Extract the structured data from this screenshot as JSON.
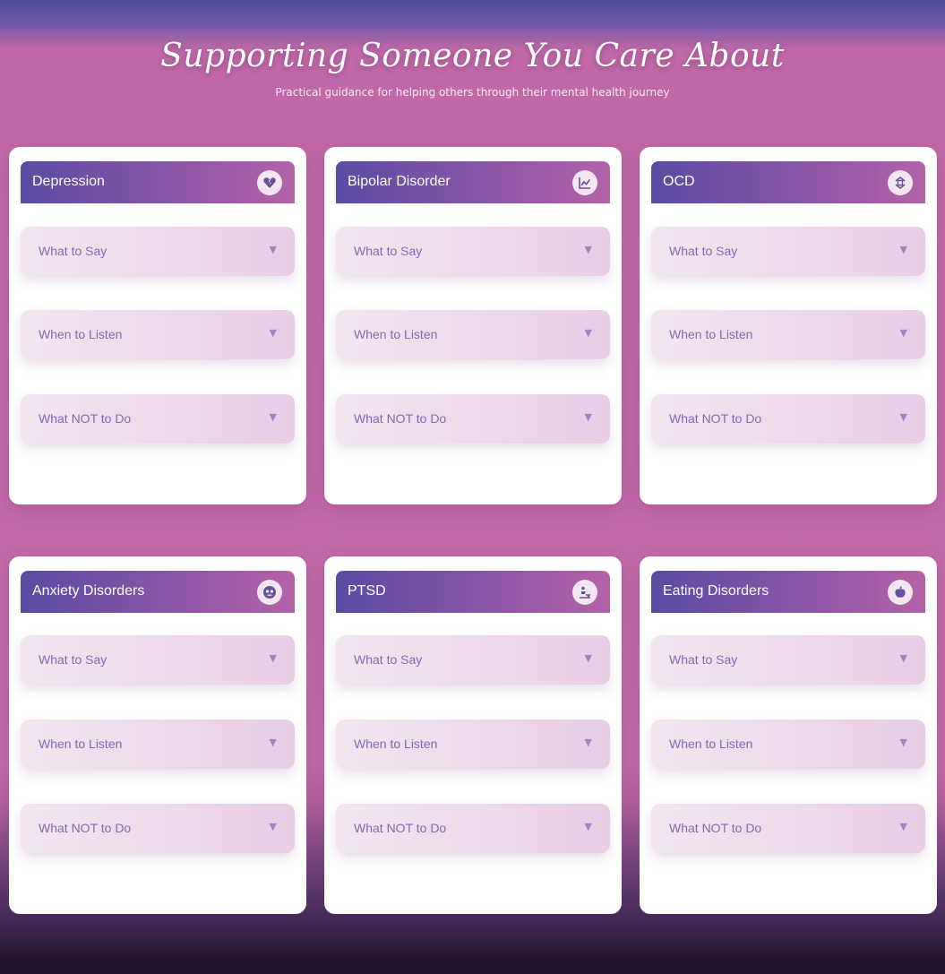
{
  "header": {
    "title": "Supporting Someone You Care About",
    "subtitle": "Practical guidance for helping others through their mental health journey"
  },
  "accordion_arrow": "▼",
  "cards": [
    {
      "title": "Depression",
      "icon": "broken-heart-icon",
      "items": [
        "What to Say",
        "When to Listen",
        "What NOT to Do"
      ]
    },
    {
      "title": "Bipolar Disorder",
      "icon": "line-chart-icon",
      "items": [
        "What to Say",
        "When to Listen",
        "What NOT to Do"
      ]
    },
    {
      "title": "OCD",
      "icon": "recycle-icon",
      "items": [
        "What to Say",
        "When to Listen",
        "What NOT to Do"
      ]
    },
    {
      "title": "Anxiety Disorders",
      "icon": "anxious-face-icon",
      "items": [
        "What to Say",
        "When to Listen",
        "What NOT to Do"
      ]
    },
    {
      "title": "PTSD",
      "icon": "person-shield-icon",
      "items": [
        "What to Say",
        "When to Listen",
        "What NOT to Do"
      ]
    },
    {
      "title": "Eating Disorders",
      "icon": "apple-icon",
      "items": [
        "What to Say",
        "When to Listen",
        "What NOT to Do"
      ]
    }
  ],
  "colors": {
    "header_gradient_start": "#5a4ba3",
    "header_gradient_end": "#b462a8",
    "accordion_text": "#8169b2",
    "page_background": "#c46aa8"
  }
}
